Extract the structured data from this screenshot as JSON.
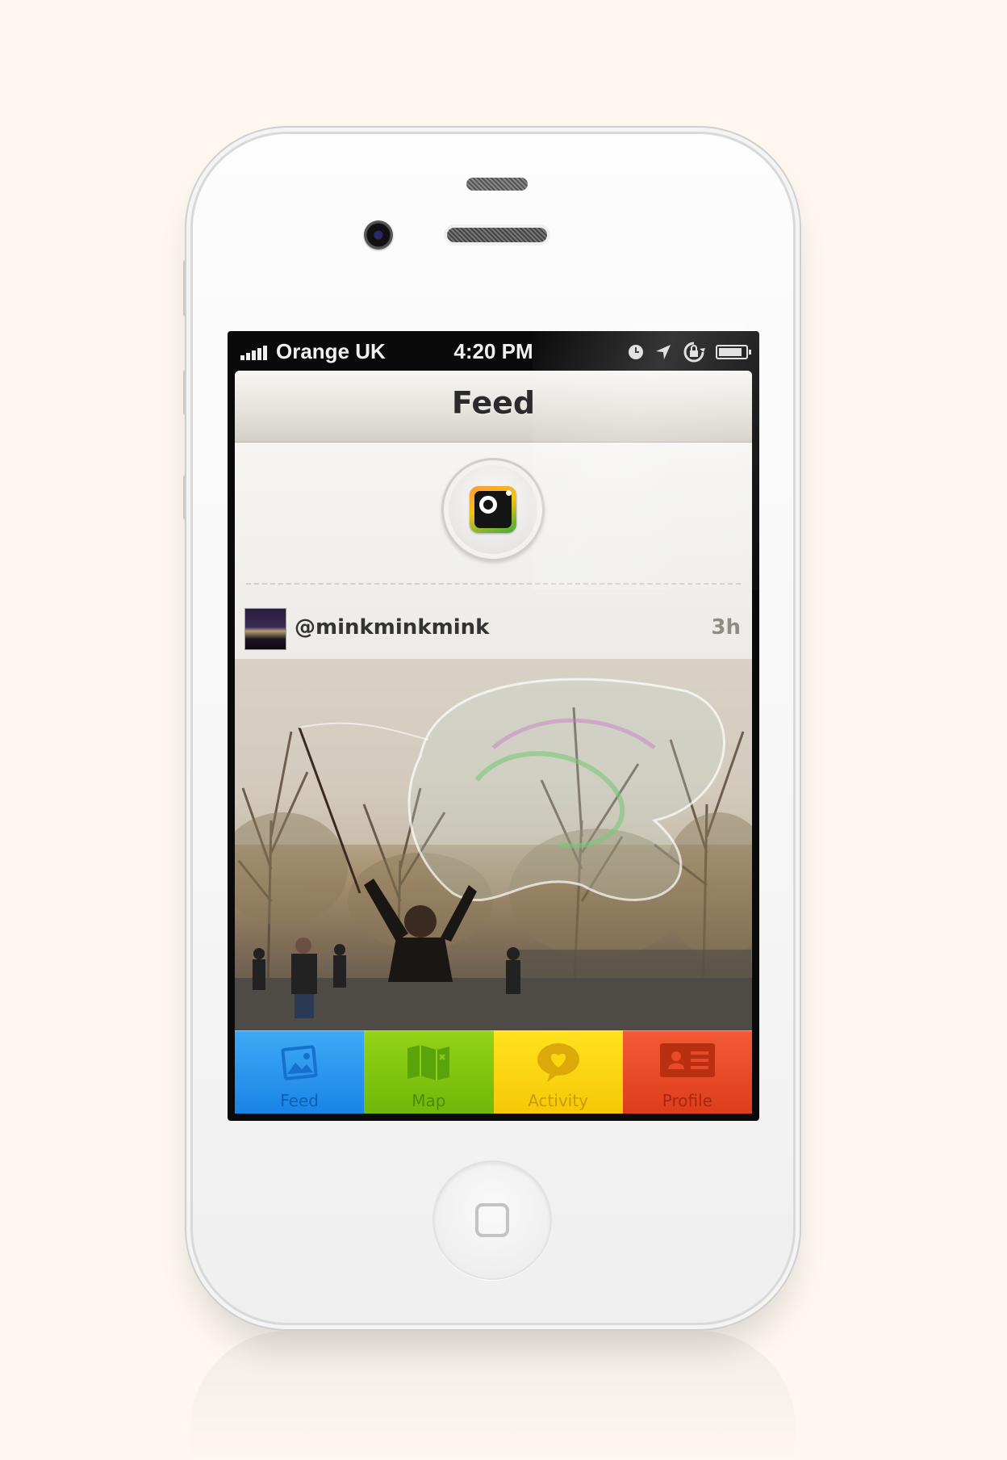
{
  "status_bar": {
    "carrier": "Orange UK",
    "time": "4:20 PM"
  },
  "nav": {
    "title": "Feed"
  },
  "post": {
    "username": "@minkminkmink",
    "age": "3h"
  },
  "tabs": [
    {
      "label": "Feed",
      "icon": "photo-icon",
      "color": "#2196f0"
    },
    {
      "label": "Map",
      "icon": "map-icon",
      "color": "#7dc30f"
    },
    {
      "label": "Activity",
      "icon": "heart-bubble-icon",
      "color": "#fbd510"
    },
    {
      "label": "Profile",
      "icon": "id-card-icon",
      "color": "#e9492a"
    }
  ]
}
